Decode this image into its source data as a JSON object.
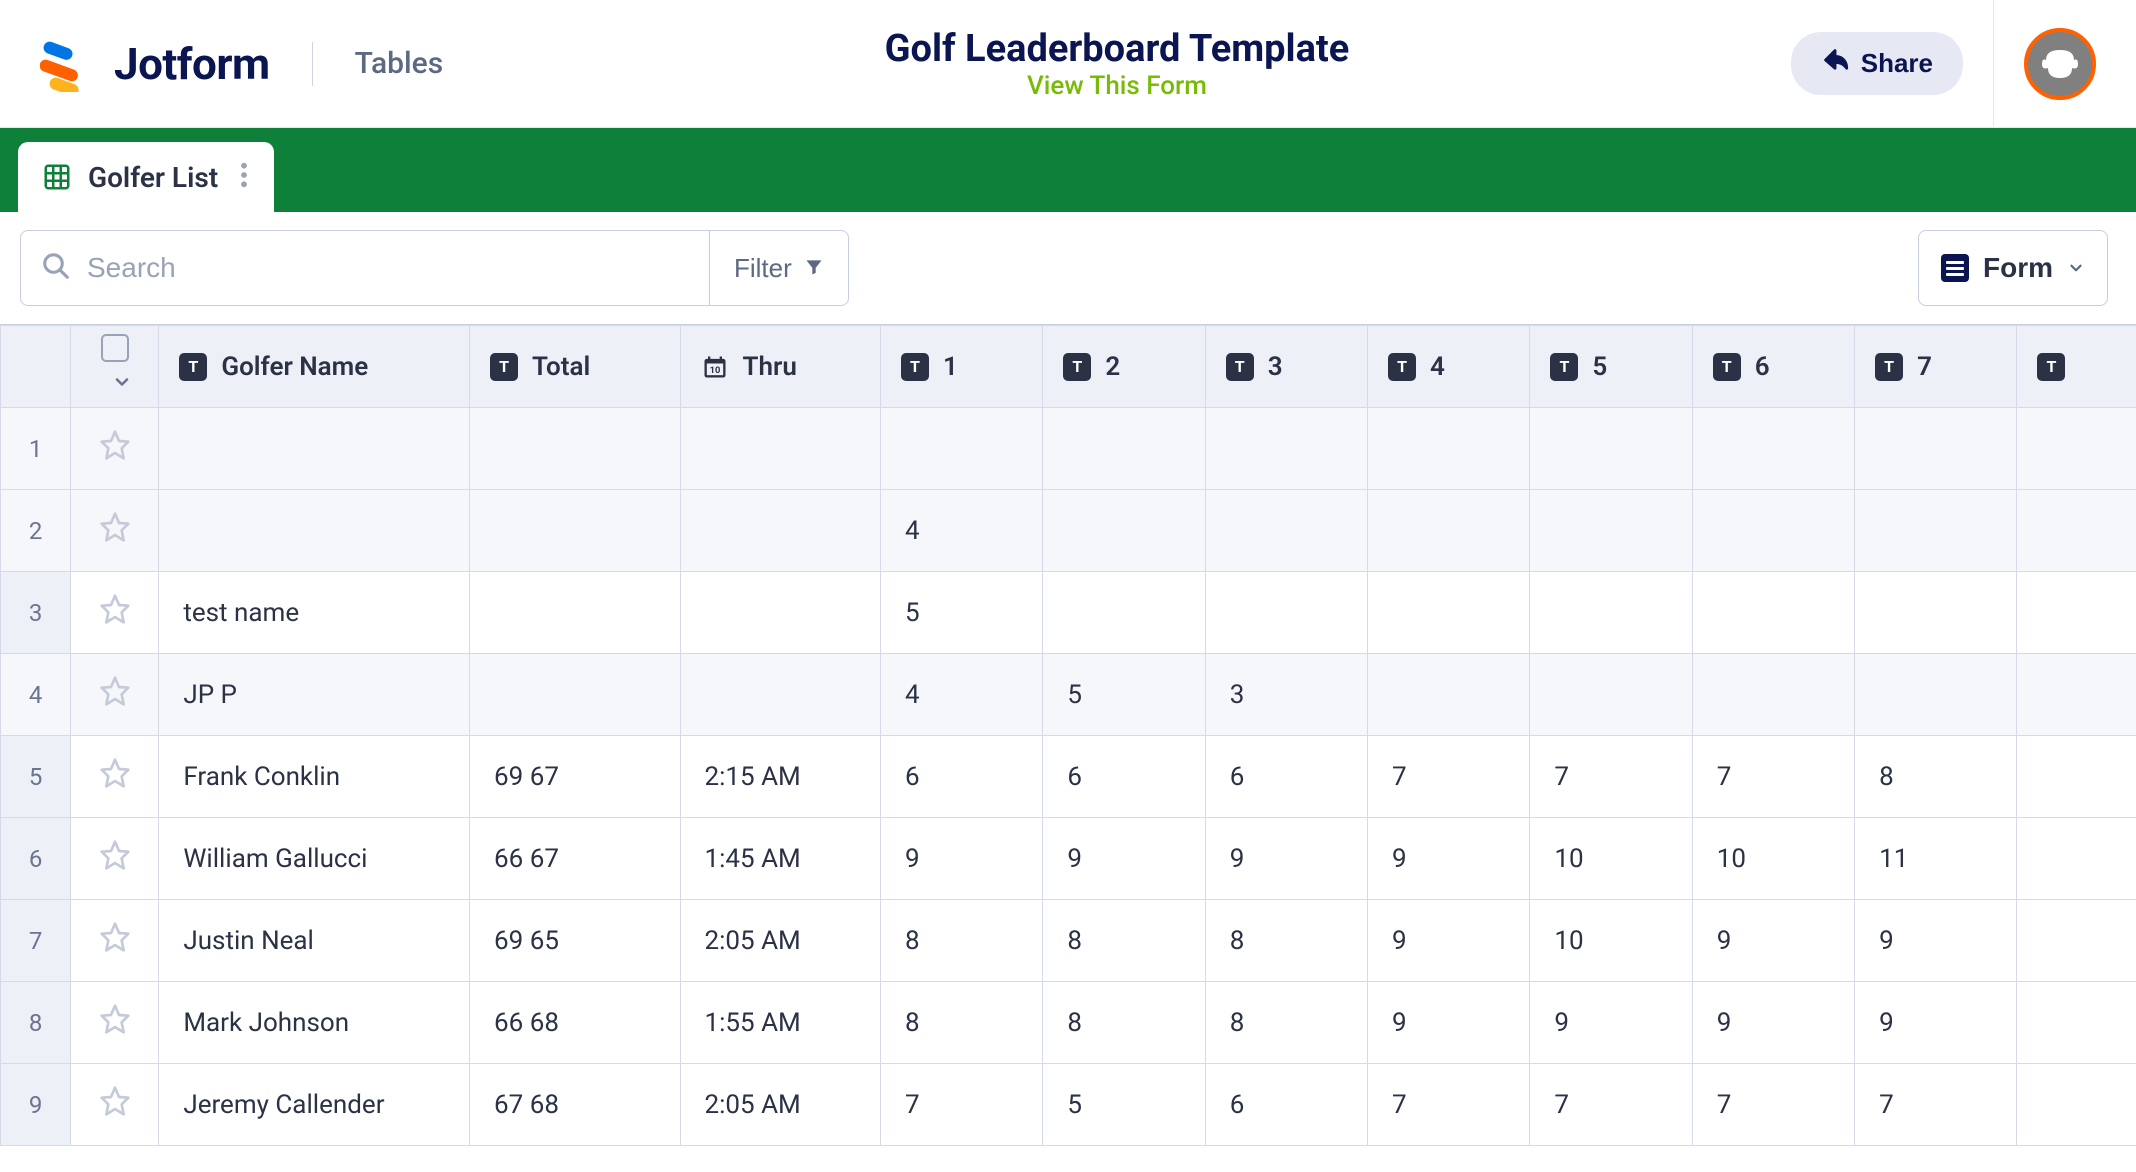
{
  "brand": {
    "name": "Jotform",
    "section": "Tables"
  },
  "page": {
    "title": "Golf Leaderboard Template",
    "view_link": "View This Form"
  },
  "actions": {
    "share": "Share",
    "filter": "Filter",
    "form_dropdown": "Form"
  },
  "tab": {
    "label": "Golfer List"
  },
  "search": {
    "placeholder": "Search"
  },
  "columns": {
    "name": "Golfer Name",
    "total": "Total",
    "thru": "Thru",
    "holes": [
      "1",
      "2",
      "3",
      "4",
      "5",
      "6",
      "7"
    ]
  },
  "rows": [
    {
      "idx": "1",
      "name": "",
      "total": "",
      "thru": "",
      "h": [
        "",
        "",
        "",
        "",
        "",
        "",
        ""
      ]
    },
    {
      "idx": "2",
      "name": "",
      "total": "",
      "thru": "",
      "h": [
        "4",
        "",
        "",
        "",
        "",
        "",
        ""
      ]
    },
    {
      "idx": "3",
      "name": "test name",
      "total": "",
      "thru": "",
      "h": [
        "5",
        "",
        "",
        "",
        "",
        "",
        ""
      ]
    },
    {
      "idx": "4",
      "name": "JP P",
      "total": "",
      "thru": "",
      "h": [
        "4",
        "5",
        "3",
        "",
        "",
        "",
        ""
      ]
    },
    {
      "idx": "5",
      "name": "Frank Conklin",
      "total": "69 67",
      "thru": "2:15 AM",
      "h": [
        "6",
        "6",
        "6",
        "7",
        "7",
        "7",
        "8"
      ]
    },
    {
      "idx": "6",
      "name": "William Gallucci",
      "total": "66 67",
      "thru": "1:45 AM",
      "h": [
        "9",
        "9",
        "9",
        "9",
        "10",
        "10",
        "11"
      ]
    },
    {
      "idx": "7",
      "name": "Justin Neal",
      "total": "69 65",
      "thru": "2:05 AM",
      "h": [
        "8",
        "8",
        "8",
        "9",
        "10",
        "9",
        "9"
      ]
    },
    {
      "idx": "8",
      "name": "Mark Johnson",
      "total": "66 68",
      "thru": "1:55 AM",
      "h": [
        "8",
        "8",
        "8",
        "9",
        "9",
        "9",
        "9"
      ]
    },
    {
      "idx": "9",
      "name": "Jeremy Callender",
      "total": "67 68",
      "thru": "2:05 AM",
      "h": [
        "7",
        "5",
        "6",
        "7",
        "7",
        "7",
        "7"
      ]
    }
  ]
}
